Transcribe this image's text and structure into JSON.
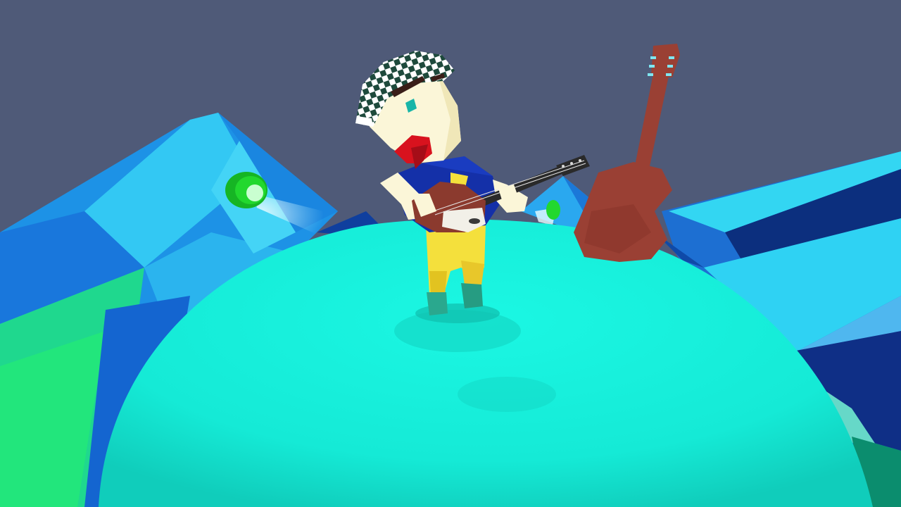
{
  "scene": {
    "sky_color": "#4f5a78",
    "planet_color": "#17f0dc",
    "planet_shadow_color": "#0fcbb9",
    "mountain_colors": {
      "light": "#33c8f3",
      "mid": "#1d92e6",
      "dark": "#0f4aa8",
      "deep": "#0c2f7e",
      "green": "#1fe08a"
    },
    "character": {
      "hat_pattern": "checkered",
      "hat_colors": [
        "#ffffff",
        "#1e4a3c"
      ],
      "skin_color": "#fbf6d8",
      "shirt_color": "#1430a8",
      "pants_color": "#f4e03c",
      "shoe_color": "#2aa88e",
      "mouth_color": "#d8121e"
    },
    "guitar": {
      "body_color": "#8b3a2e",
      "neck_color": "#2a2a2a",
      "pickguard_color": "#f2f0e8"
    },
    "floating_guitar": {
      "color": "#9a4034",
      "tuner_color": "#7fe6f0"
    },
    "lights": {
      "lamp_color": "#22d82e",
      "beam_color": "#eafcff"
    }
  }
}
